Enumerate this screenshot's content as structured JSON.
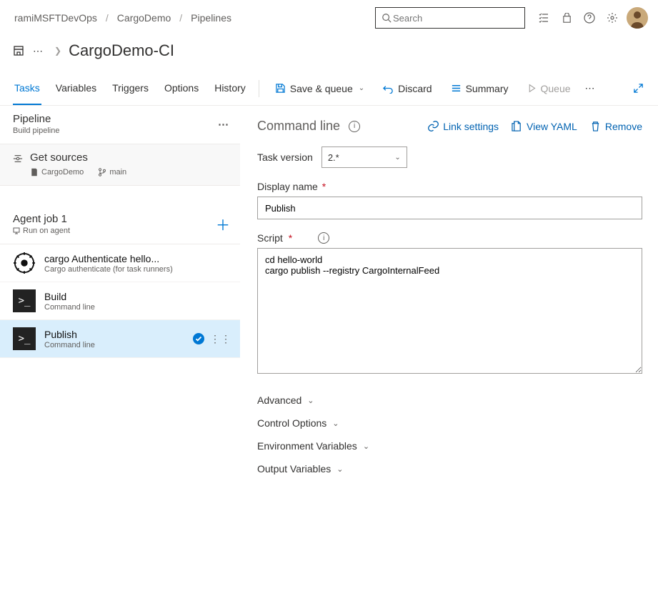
{
  "breadcrumb": [
    "ramiMSFTDevOps",
    "CargoDemo",
    "Pipelines"
  ],
  "search": {
    "placeholder": "Search"
  },
  "page_title": "CargoDemo-CI",
  "tabs": [
    "Tasks",
    "Variables",
    "Triggers",
    "Options",
    "History"
  ],
  "active_tab": 0,
  "toolbar": {
    "save_queue": "Save & queue",
    "discard": "Discard",
    "summary": "Summary",
    "queue": "Queue"
  },
  "pipeline": {
    "title": "Pipeline",
    "subtitle": "Build pipeline"
  },
  "get_sources": {
    "title": "Get sources",
    "repo": "CargoDemo",
    "branch": "main"
  },
  "agent_job": {
    "title": "Agent job 1",
    "subtitle": "Run on agent"
  },
  "tasks": [
    {
      "title": "cargo Authenticate hello...",
      "subtitle": "Cargo authenticate (for task runners)",
      "icon": "rust"
    },
    {
      "title": "Build",
      "subtitle": "Command line",
      "icon": "cmd"
    },
    {
      "title": "Publish",
      "subtitle": "Command line",
      "icon": "cmd",
      "selected": true
    }
  ],
  "detail": {
    "title": "Command line",
    "links": {
      "link_settings": "Link settings",
      "view_yaml": "View YAML",
      "remove": "Remove"
    },
    "task_version_label": "Task version",
    "task_version_value": "2.*",
    "display_name_label": "Display name",
    "display_name_value": "Publish",
    "script_label": "Script",
    "script_value": "cd hello-world\ncargo publish --registry CargoInternalFeed",
    "sections": [
      "Advanced",
      "Control Options",
      "Environment Variables",
      "Output Variables"
    ]
  }
}
